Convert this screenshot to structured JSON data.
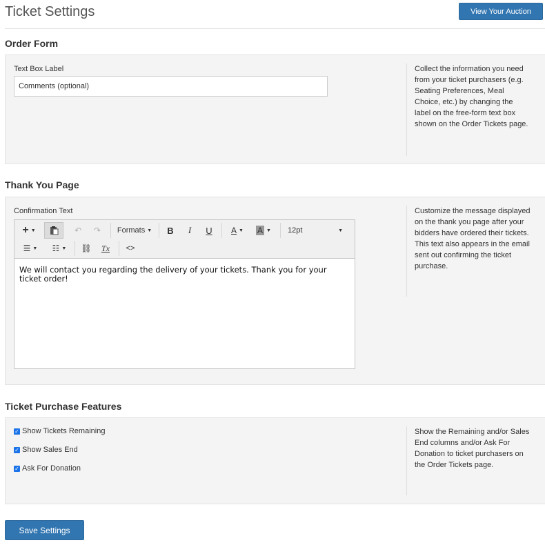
{
  "page": {
    "title": "Ticket Settings",
    "view_auction_label": "View Your Auction",
    "save_label": "Save Settings"
  },
  "order_form": {
    "section_title": "Order Form",
    "field_label": "Text Box Label",
    "field_value": "Comments (optional)",
    "help_text": "Collect the information you need from your ticket purchasers (e.g. Seating Preferences, Meal Choice, etc.) by changing the label on the free-form text box shown on the Order Tickets page."
  },
  "thank_you": {
    "section_title": "Thank You Page",
    "field_label": "Confirmation Text",
    "editor_text": "We will contact you regarding the delivery of your tickets. Thank you for your ticket order!",
    "help_text": "Customize the message displayed on the thank you page after your bidders have ordered their tickets. This text also appears in the email sent out confirming the ticket purchase.",
    "toolbar": {
      "formats_label": "Formats",
      "font_size": "12pt",
      "bold_glyph": "B",
      "italic_glyph": "I",
      "underline_glyph": "U",
      "text_color_glyph": "A",
      "bg_color_glyph": "A",
      "clear_glyph": "Tx",
      "code_glyph": "<>"
    }
  },
  "features": {
    "section_title": "Ticket Purchase Features",
    "options": [
      {
        "label": "Show Tickets Remaining",
        "checked": true
      },
      {
        "label": "Show Sales End",
        "checked": true
      },
      {
        "label": "Ask For Donation",
        "checked": true
      }
    ],
    "help_text": "Show the Remaining and/or Sales End columns and/or Ask For Donation to ticket purchasers on the Order Tickets page."
  },
  "colors": {
    "primary_button": "#3276b1",
    "panel_bg": "#f4f4f4",
    "checkbox": "#1a73e8"
  }
}
